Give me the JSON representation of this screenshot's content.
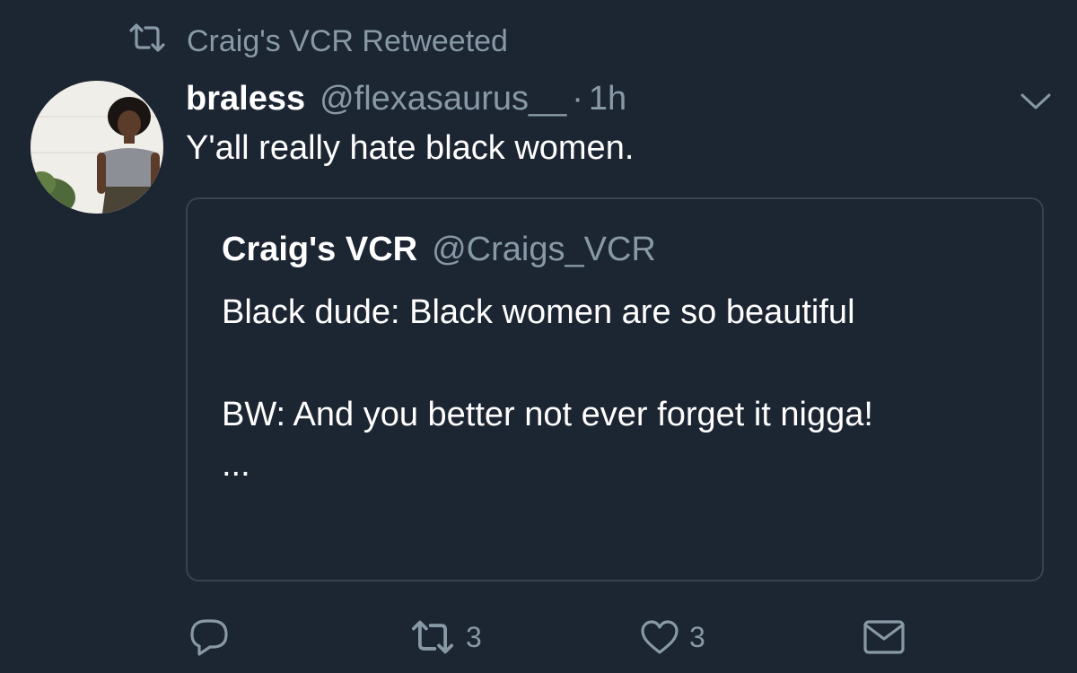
{
  "retweet_banner": {
    "text": "Craig's VCR Retweeted",
    "icon": "retweet-icon"
  },
  "tweet": {
    "display_name": "braless",
    "handle": "@flexasaurus__",
    "separator": "·",
    "time": "1h",
    "text": "Y'all really hate black women.",
    "avatar": "user-avatar-photo"
  },
  "quoted_tweet": {
    "display_name": "Craig's VCR",
    "handle": "@Craigs_VCR",
    "lines": {
      "line1": "Black dude: Black women are so beautiful",
      "line2": "BW: And you better not ever forget it nigga!",
      "line3": "..."
    }
  },
  "actions": {
    "reply": {
      "icon": "reply-icon"
    },
    "retweet": {
      "icon": "retweet-icon",
      "count": "3"
    },
    "like": {
      "icon": "heart-icon",
      "count": "3"
    },
    "message": {
      "icon": "mail-icon"
    }
  },
  "colors": {
    "background": "#1c2532",
    "secondary_text": "#8899a6",
    "card_border": "#38444d",
    "primary_text": "#ffffff"
  }
}
